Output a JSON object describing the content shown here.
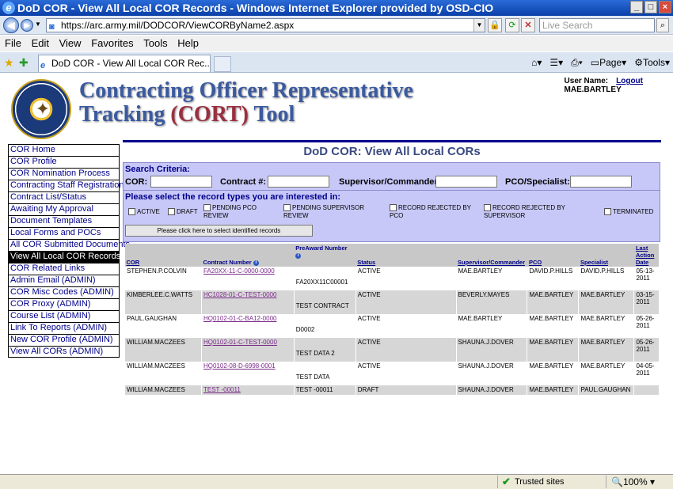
{
  "window": {
    "title": "DoD COR - View All Local COR Records - Windows Internet Explorer provided by OSD-CIO"
  },
  "address": {
    "url": "https://arc.army.mil/DODCOR/ViewCORByName2.aspx",
    "search_placeholder": "Live Search"
  },
  "menu": [
    "File",
    "Edit",
    "View",
    "Favorites",
    "Tools",
    "Help"
  ],
  "tab": {
    "label": "DoD COR - View All Local COR Rec..."
  },
  "toolbar": {
    "page": "Page",
    "tools": "Tools"
  },
  "header": {
    "title_line1": "Contracting Officer Representative",
    "title_line2_a": "Tracking ",
    "title_line2_b": "(CORT)",
    "title_line2_c": " Tool",
    "user_label": "User Name:",
    "logout": "Logout",
    "user": "MAE.BARTLEY"
  },
  "nav": [
    "COR Home",
    "COR Profile",
    "COR Nomination Process",
    "Contracting Staff Registration",
    "Contract List/Status",
    "Awaiting My Approval",
    "Document Templates",
    "Local Forms and POCs",
    "All COR Submitted Documents",
    "View All Local COR Records",
    "COR Related Links",
    "Admin Email (ADMIN)",
    "COR Misc Codes (ADMIN)",
    "COR Proxy (ADMIN)",
    "Course List (ADMIN)",
    "Link To Reports (ADMIN)",
    "New COR Profile (ADMIN)",
    "View All CORs (ADMIN)"
  ],
  "page_title": "DoD COR: View All Local CORs",
  "criteria": {
    "heading": "Search Criteria:",
    "cor": "COR:",
    "contract": "Contract #:",
    "supervisor": "Supervisor/Commander:",
    "pco": "PCO/Specialist:",
    "please": "Please select the record types you are interested in:",
    "types": [
      "ACTIVE",
      "DRAFT",
      "PENDING PCO REVIEW",
      "PENDING SUPERVISOR REVIEW",
      "RECORD REJECTED BY PCO",
      "RECORD REJECTED BY SUPERVISOR",
      "TERMINATED"
    ],
    "button": "Please click here to select identified records"
  },
  "table": {
    "headers": {
      "cor": "COR",
      "contract": "Contract Number",
      "preaward": "PreAward Number",
      "status": "Status",
      "supervisor": "Supervisor/Commander",
      "pco": "PCO",
      "specialist": "Specialist",
      "last_action": "Last Action Date"
    },
    "rows": [
      {
        "cor": "STEPHEN.P.COLVIN",
        "contract": "FA20XX-11-C-0000-0000",
        "preaward": "FA20XX11C00001",
        "status": "ACTIVE",
        "supervisor": "MAE.BARTLEY",
        "pco": "DAVID.P.HILLS",
        "specialist": "DAVID.P.HILLS",
        "date": "05-13-2011"
      },
      {
        "cor": "KIMBERLEE.C.WATTS",
        "contract": "HC1028-01-C-TEST-0000",
        "preaward": "TEST CONTRACT",
        "status": "ACTIVE",
        "supervisor": "BEVERLY.MAYES",
        "pco": "MAE.BARTLEY",
        "specialist": "MAE.BARTLEY",
        "date": "03-15-2011"
      },
      {
        "cor": "PAUL.GAUGHAN",
        "contract": "HQ0102-01-C-BA12-0000",
        "preaward": "D0002",
        "status": "ACTIVE",
        "supervisor": "MAE.BARTLEY",
        "pco": "MAE.BARTLEY",
        "specialist": "MAE.BARTLEY",
        "date": "05-26-2011"
      },
      {
        "cor": "WILLIAM.MACZEES",
        "contract": "HQ0102-01-C-TEST-0000",
        "preaward": "TEST DATA 2",
        "status": "ACTIVE",
        "supervisor": "SHAUNA.J.DOVER",
        "pco": "MAE.BARTLEY",
        "specialist": "MAE.BARTLEY",
        "date": "05-26-2011"
      },
      {
        "cor": "WILLIAM.MACZEES",
        "contract": "HQ0102-08-D-6998-0001",
        "preaward": "TEST DATA",
        "status": "ACTIVE",
        "supervisor": "SHAUNA.J.DOVER",
        "pco": "MAE.BARTLEY",
        "specialist": "MAE.BARTLEY",
        "date": "04-05-2011"
      },
      {
        "cor": "WILLIAM.MACZEES",
        "contract": "TEST -00011",
        "preaward": "TEST -00011",
        "status": "DRAFT",
        "supervisor": "SHAUNA.J.DOVER",
        "pco": "MAE.BARTLEY",
        "specialist": "PAUL.GAUGHAN",
        "date": ""
      }
    ]
  },
  "status": {
    "zone": "Trusted sites",
    "zoom": "100%"
  }
}
